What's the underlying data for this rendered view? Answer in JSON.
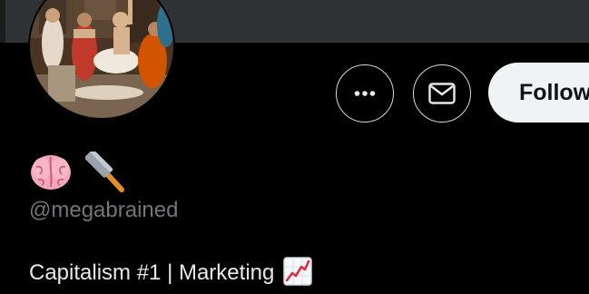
{
  "profile": {
    "handle": "@megabrained",
    "bio_text": "Capitalism #1 | Marketing",
    "name_icons": [
      "brain-emoji-icon",
      "hammer-emoji-icon"
    ],
    "bio_icon": "chart-increasing-emoji-icon",
    "avatar_icon": "avatar-painting-image"
  },
  "actions": {
    "more_icon": "more-options-icon",
    "message_icon": "envelope-icon",
    "follow_label": "Follow"
  },
  "colors": {
    "background": "#000000",
    "banner": "#2f3336",
    "button_border": "#d9d9d9",
    "follow_bg": "#eff3f4",
    "follow_text": "#0f1419",
    "handle_text": "#71767b",
    "bio_text": "#e7e9ea"
  }
}
